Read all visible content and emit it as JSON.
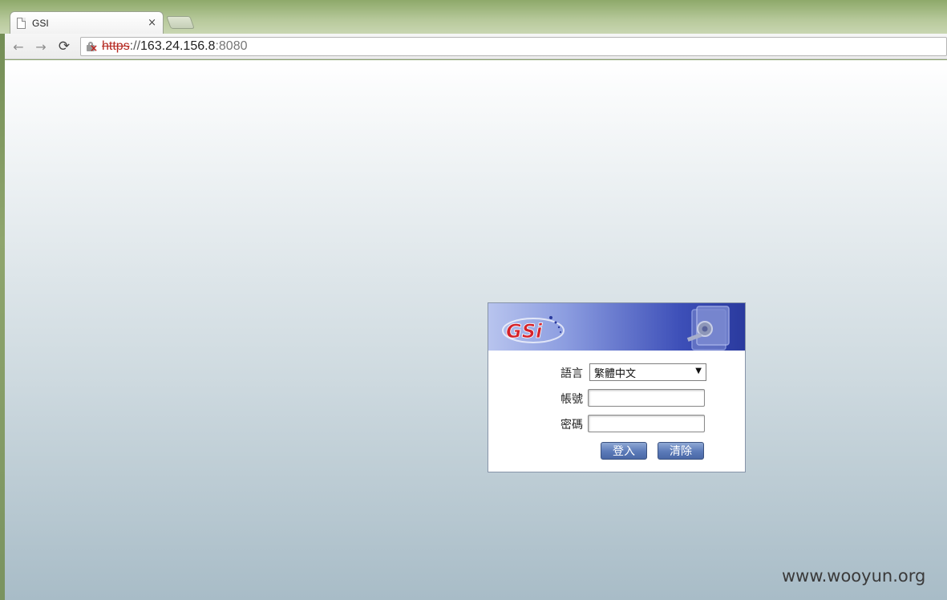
{
  "browser": {
    "tab_title": "GSI",
    "tab_close": "×",
    "url_scheme": "https",
    "url_sep": "://",
    "url_host": "163.24.156.8",
    "url_port": ":8080",
    "nav_back": "←",
    "nav_forward": "→",
    "nav_reload": "⟳"
  },
  "login": {
    "logo_text": "GSi",
    "language_label": "語言",
    "language_selected": "繁體中文",
    "account_label": "帳號",
    "password_label": "密碼",
    "login_button": "登入",
    "clear_button": "清除"
  },
  "watermark": "www.wooyun.org",
  "colors": {
    "banner_dark": "#2a3a9e",
    "banner_light": "#b8c4ee",
    "button_blue": "#5b7ab8",
    "logo_red": "#d4222a"
  }
}
